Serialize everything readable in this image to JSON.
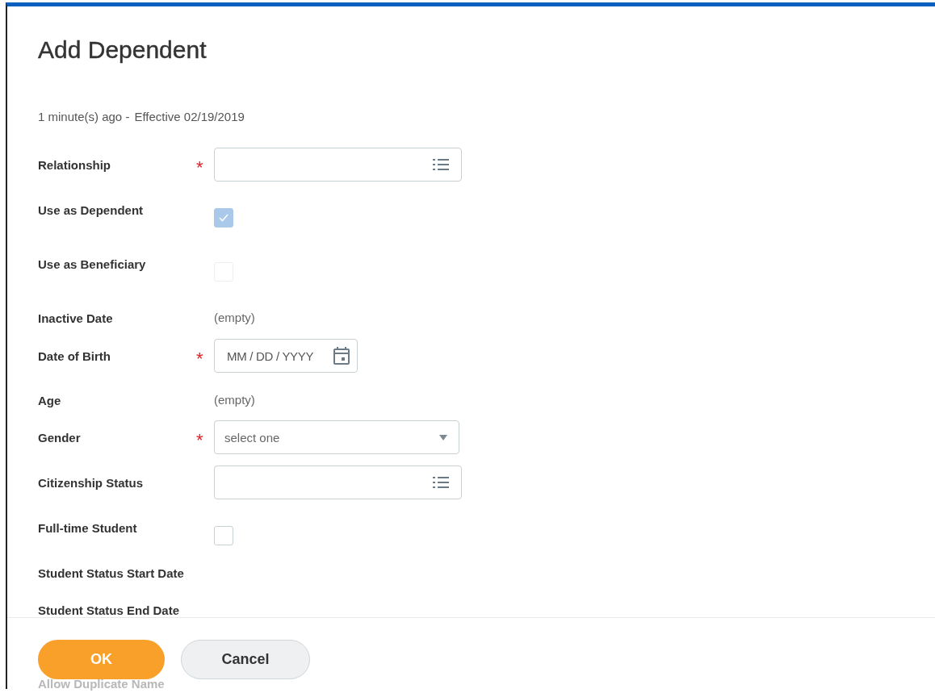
{
  "title": "Add Dependent",
  "meta": {
    "time": "1 minute(s) ago -",
    "effective": "Effective 02/19/2019"
  },
  "fields": [
    {
      "kind": "list",
      "label": "Relationship",
      "required_mark": "*"
    },
    {
      "kind": "checkbox",
      "label": "Use as Dependent",
      "checked": true,
      "disabled": true
    },
    {
      "kind": "checkbox",
      "label": "Use as Beneficiary",
      "checked": false,
      "disabled": true
    },
    {
      "kind": "text",
      "label": "Inactive Date",
      "value": "(empty)"
    },
    {
      "kind": "date",
      "label": "Date of Birth",
      "required_mark": "*",
      "placeholder": "MM / DD / YYYY"
    },
    {
      "kind": "text",
      "label": "Age",
      "value": "(empty)"
    },
    {
      "kind": "dropdown",
      "label": "Gender",
      "required_mark": "*",
      "placeholder": "select one"
    },
    {
      "kind": "list",
      "label": "Citizenship Status"
    },
    {
      "kind": "checkbox",
      "label": "Full-time Student",
      "checked": false,
      "disabled": false
    },
    {
      "kind": "label",
      "label": "Student Status Start Date"
    },
    {
      "kind": "label",
      "label": "Student Status End Date"
    },
    {
      "kind": "faded",
      "label": "Allow Duplicate Name"
    }
  ],
  "buttons": [
    {
      "label": "OK",
      "kind": "primary"
    },
    {
      "label": "Cancel",
      "kind": "secondary"
    }
  ]
}
